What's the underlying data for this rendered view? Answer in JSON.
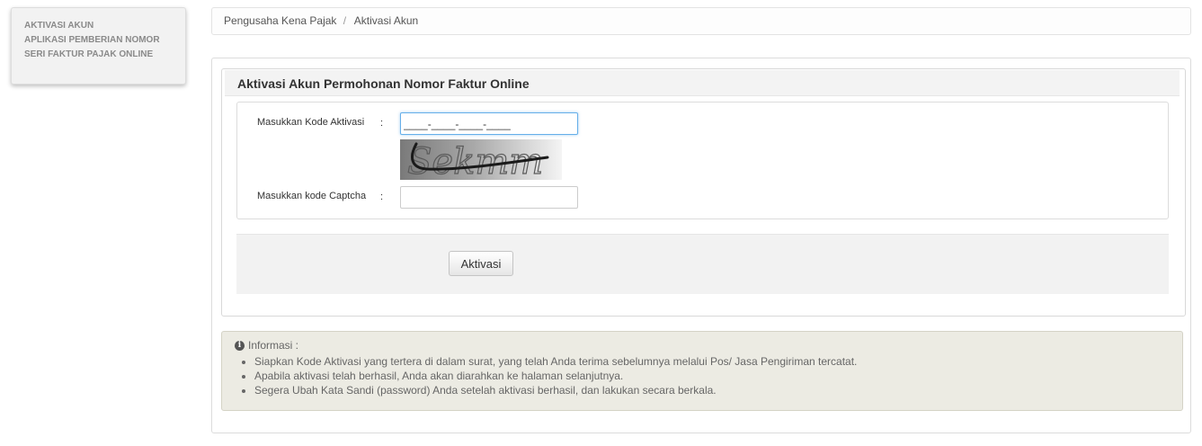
{
  "sidebar": {
    "items": [
      "AKTIVASI AKUN",
      "APLIKASI PEMBERIAN NOMOR",
      "SERI FAKTUR PAJAK ONLINE"
    ]
  },
  "breadcrumb": {
    "parent": "Pengusaha Kena Pajak",
    "separator": "/",
    "current": "Aktivasi Akun"
  },
  "form": {
    "heading": "Aktivasi Akun Permohonan Nomor Faktur Online",
    "activation_label": "Masukkan Kode Aktivasi",
    "activation_colon": ":",
    "activation_value": "____-____-____-____",
    "captcha_text": "Sekmm",
    "captcha_label": "Masukkan kode Captcha",
    "captcha_colon": ":",
    "captcha_value": "",
    "submit_label": "Aktivasi"
  },
  "info": {
    "icon": "info-circle-icon",
    "title": "Informasi :",
    "items": [
      "Siapkan Kode Aktivasi yang tertera di dalam surat, yang telah Anda terima sebelumnya melalui Pos/ Jasa Pengiriman tercatat.",
      "Apabila aktivasi telah berhasil, Anda akan diarahkan ke halaman selanjutnya.",
      "Segera Ubah Kata Sandi (password) Anda setelah aktivasi berhasil, dan lakukan secara berkala."
    ]
  },
  "colors": {
    "focus_border": "#66afe9",
    "info_background": "#ecebe3",
    "panel_header": "#f3f3f3"
  }
}
